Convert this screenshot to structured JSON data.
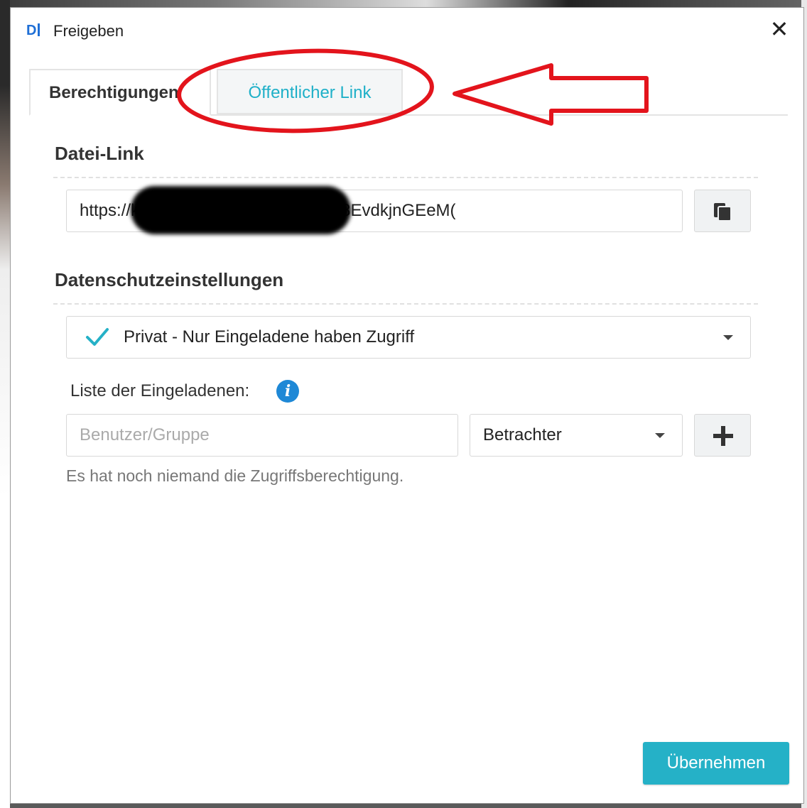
{
  "window": {
    "title": "Freigeben",
    "logo_text": "D",
    "close_symbol": "✕"
  },
  "tabs": [
    {
      "label": "Berechtigungen",
      "active": true
    },
    {
      "label": "Öffentlicher Link",
      "active": false
    }
  ],
  "file_link": {
    "section_title": "Datei-Link",
    "url_visible": "https://k                                        01/d/f/qxX1M5kMUutpmm8EvdkjnGEeM(",
    "copy_icon": "copy-icon"
  },
  "privacy": {
    "section_title": "Datenschutzeinstellungen",
    "selected": "Privat - Nur Eingeladene haben Zugriff"
  },
  "invitees": {
    "label": "Liste der Eingeladenen:",
    "input_placeholder": "Benutzer/Gruppe",
    "role_selected": "Betrachter",
    "empty_message": "Es hat noch niemand die Zugriffsberechtigung."
  },
  "footer": {
    "apply_label": "Übernehmen"
  },
  "colors": {
    "accent": "#25b1c7",
    "annotation": "#e3141c",
    "info": "#1e88d6"
  }
}
